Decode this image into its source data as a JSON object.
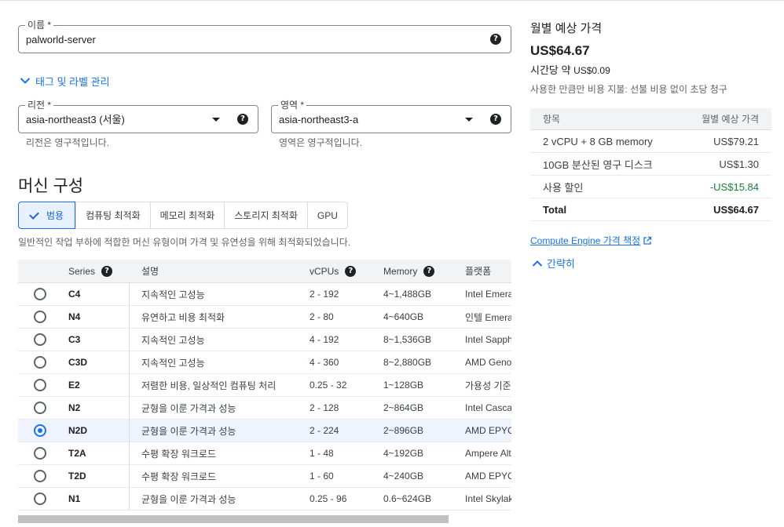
{
  "name_field": {
    "label": "이름 *",
    "value": "palworld-server"
  },
  "tags_link": "태그 및 라벨 관리",
  "region": {
    "label": "리전 *",
    "value": "asia-northeast3 (서울)",
    "hint": "리전은 영구적입니다."
  },
  "zone": {
    "label": "영역 *",
    "value": "asia-northeast3-a",
    "hint": "영역은 영구적입니다."
  },
  "machine": {
    "title": "머신 구성",
    "tabs": [
      "범용",
      "컴퓨팅 최적화",
      "메모리 최적화",
      "스토리지 최적화",
      "GPU"
    ],
    "active_tab": "범용",
    "description": "일반적인 작업 부하에 적합한 머신 유형이며 가격 및 유연성을 위해 최적화되었습니다.",
    "columns": [
      "Series",
      "설명",
      "vCPUs",
      "Memory",
      "플랫폼"
    ],
    "rows": [
      {
        "series": "C4",
        "desc": "지속적인 고성능",
        "vcpus": "2 - 192",
        "memory": "4~1,488GB",
        "platform": "Intel Emera"
      },
      {
        "series": "N4",
        "desc": "유연하고 비용 최적화",
        "vcpus": "2 - 80",
        "memory": "4~640GB",
        "platform": "인텔 Emera"
      },
      {
        "series": "C3",
        "desc": "지속적인 고성능",
        "vcpus": "4 - 192",
        "memory": "8~1,536GB",
        "platform": "Intel Sapph"
      },
      {
        "series": "C3D",
        "desc": "지속적인 고성능",
        "vcpus": "4 - 360",
        "memory": "8~2,880GB",
        "platform": "AMD Genoa"
      },
      {
        "series": "E2",
        "desc": "저렴한 비용, 일상적인 컴퓨팅 처리",
        "vcpus": "0.25 - 32",
        "memory": "1~128GB",
        "platform": "가용성 기준"
      },
      {
        "series": "N2",
        "desc": "균형을 이룬 가격과 성능",
        "vcpus": "2 - 128",
        "memory": "2~864GB",
        "platform": "Intel Casca"
      },
      {
        "series": "N2D",
        "desc": "균형을 이룬 가격과 성능",
        "vcpus": "2 - 224",
        "memory": "2~896GB",
        "platform": "AMD EPYC"
      },
      {
        "series": "T2A",
        "desc": "수평 확장 워크로드",
        "vcpus": "1 - 48",
        "memory": "4~192GB",
        "platform": "Ampere Alt"
      },
      {
        "series": "T2D",
        "desc": "수평 확장 워크로드",
        "vcpus": "1 - 60",
        "memory": "4~240GB",
        "platform": "AMD EPYC"
      },
      {
        "series": "N1",
        "desc": "균형을 이룬 가격과 성능",
        "vcpus": "0.25 - 96",
        "memory": "0.6~624GB",
        "platform": "Intel Skylak"
      }
    ],
    "selected_series": "N2D"
  },
  "pricing": {
    "title": "월별 예상 가격",
    "monthly": "US$64.67",
    "hourly_prefix": "시간당 약",
    "hourly_value": "US$0.09",
    "note": "사용한 만큼만 비용 지불: 선불 비용 없이 초당 청구",
    "header": {
      "item": "항목",
      "price": "월별 예상 가격"
    },
    "items": [
      {
        "label": "2 vCPU + 8 GB memory",
        "price": "US$79.21"
      },
      {
        "label": "10GB 분산된 영구 디스크",
        "price": "US$1.30"
      },
      {
        "label": "사용 할인",
        "price": "-US$15.84"
      }
    ],
    "total_label": "Total",
    "total_value": "US$64.67",
    "pricing_link": "Compute Engine 가격 책정",
    "collapse_link": "간략히",
    "discount_color": "#188038"
  },
  "accent_color": "#1a73e8"
}
